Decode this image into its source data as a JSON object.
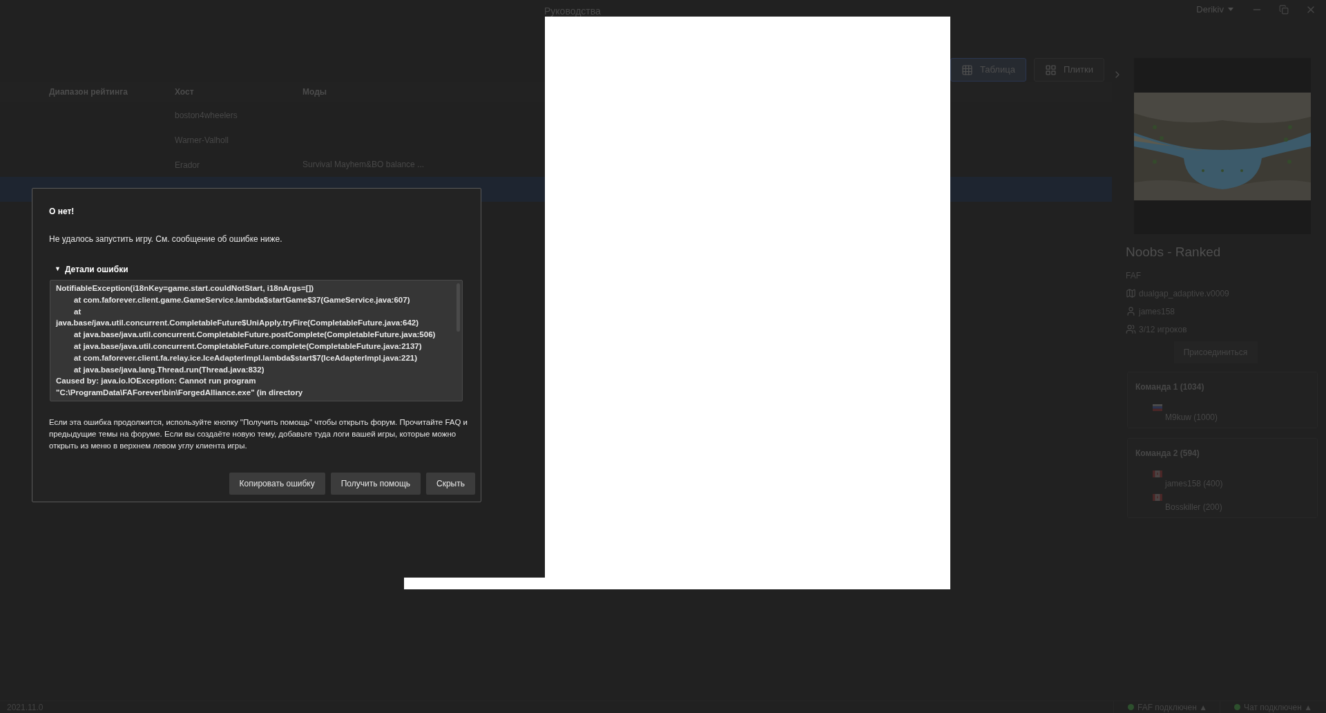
{
  "top_bar": {
    "guides": "Руководства",
    "user": "Derikiv"
  },
  "view_toggle": [
    {
      "label": "Таблица",
      "kind": "table",
      "selected": true
    },
    {
      "label": "Плитки",
      "kind": "tiles",
      "selected": false
    }
  ],
  "table": {
    "columns": [
      "Диапазон рейтинга",
      "Хост",
      "Моды"
    ],
    "rows": [
      {
        "host": "boston4wheelers",
        "selected": false
      },
      {
        "host": "Warner-Valholl",
        "selected": false
      },
      {
        "host": "Erador",
        "mods": "Survival Mayhem&BO balance ...",
        "selected": false
      },
      {
        "selected": true
      }
    ]
  },
  "game": {
    "title": "Noobs - Ranked",
    "featured_mod": "FAF",
    "map": "dualgap_adaptive.v0009",
    "host": "james158",
    "players": "3/12 игроков",
    "join_button": "Присоединиться",
    "teams": [
      {
        "title": "Команда 1 (1034)",
        "players": [
          {
            "name": "M9kuw (1000)",
            "kind": "ru"
          }
        ]
      },
      {
        "title": "Команда 2 (594)",
        "players": [
          {
            "name": "james158 (400)",
            "kind": "ca"
          },
          {
            "name": "Bosskiller (200)",
            "kind": "ca"
          }
        ]
      }
    ]
  },
  "dialog": {
    "title": "О нет!",
    "message": "Не удалось запустить игру. См. сообщение об ошибке ниже.",
    "details": {
      "toggle": "▼",
      "label": "Детали ошибки",
      "expanded": true,
      "lines": [
        {
          "text": "NotifiableException(i18nKey=game.start.couldNotStart, i18nArgs=[])",
          "indented": false
        },
        {
          "text": "at com.faforever.client.game.GameService.lambda$startGame$37(GameService.java:607)",
          "indented": true
        },
        {
          "text": "at",
          "indented": true
        },
        {
          "text": "java.base/java.util.concurrent.CompletableFuture$UniApply.tryFire(CompletableFuture.java:642)",
          "indented": false
        },
        {
          "text": "at java.base/java.util.concurrent.CompletableFuture.postComplete(CompletableFuture.java:506)",
          "indented": true
        },
        {
          "text": "at java.base/java.util.concurrent.CompletableFuture.complete(CompletableFuture.java:2137)",
          "indented": true
        },
        {
          "text": "at com.faforever.client.fa.relay.ice.IceAdapterImpl.lambda$start$7(IceAdapterImpl.java:221)",
          "indented": true
        },
        {
          "text": "at java.base/java.lang.Thread.run(Thread.java:832)",
          "indented": true
        },
        {
          "text": "Caused by: java.io.IOException: Cannot run program",
          "indented": false
        },
        {
          "text": "\"C:\\ProgramData\\FAForever\\bin\\ForgedAlliance.exe\" (in directory",
          "indented": false
        }
      ]
    },
    "help_text": "Если эта ошибка продолжится, используйте кнопку \"Получить помощь\" чтобы открыть форум. Прочитайте FAQ и предыдущие темы на форуме. Если вы создаёте новую тему, добавьте туда логи вашей игры, которые можно открыть из меню в верхнем левом углу клиента игры.",
    "buttons": [
      "Копировать ошибку",
      "Получить помощь",
      "Скрыть"
    ]
  },
  "status_bar": {
    "version": "2021.11.0",
    "connections": [
      {
        "label": "FAF подключен",
        "arrow": "▲",
        "connected": true
      },
      {
        "label": "Чат подключен",
        "arrow": "▲",
        "connected": true
      }
    ]
  }
}
